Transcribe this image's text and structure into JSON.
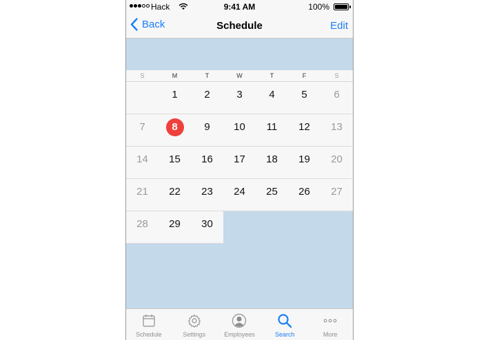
{
  "status_bar": {
    "carrier": "Hack",
    "time": "9:41 AM",
    "battery": "100%",
    "battery_level": 1.0
  },
  "nav": {
    "back_label": "Back",
    "title": "Schedule",
    "edit_label": "Edit"
  },
  "calendar": {
    "weekdays": [
      "S",
      "M",
      "T",
      "W",
      "T",
      "F",
      "S"
    ],
    "weeks": [
      [
        "",
        "1",
        "2",
        "3",
        "4",
        "5",
        "6"
      ],
      [
        "7",
        "8",
        "9",
        "10",
        "11",
        "12",
        "13"
      ],
      [
        "14",
        "15",
        "16",
        "17",
        "18",
        "19",
        "20"
      ],
      [
        "21",
        "22",
        "23",
        "24",
        "25",
        "26",
        "27"
      ],
      [
        "28",
        "29",
        "30",
        "",
        "",
        "",
        ""
      ]
    ],
    "today": "8",
    "today_color": "#f0403c"
  },
  "tabs": [
    {
      "label": "Schedule",
      "icon": "calendar-icon"
    },
    {
      "label": "Settings",
      "icon": "gear-icon"
    },
    {
      "label": "Employees",
      "icon": "person-icon"
    },
    {
      "label": "Search",
      "icon": "search-icon",
      "active": true
    },
    {
      "label": "More",
      "icon": "more-icon"
    }
  ],
  "colors": {
    "accent": "#1a7ef5",
    "background": "#c4d9ea",
    "bar": "#f7f7f7"
  }
}
